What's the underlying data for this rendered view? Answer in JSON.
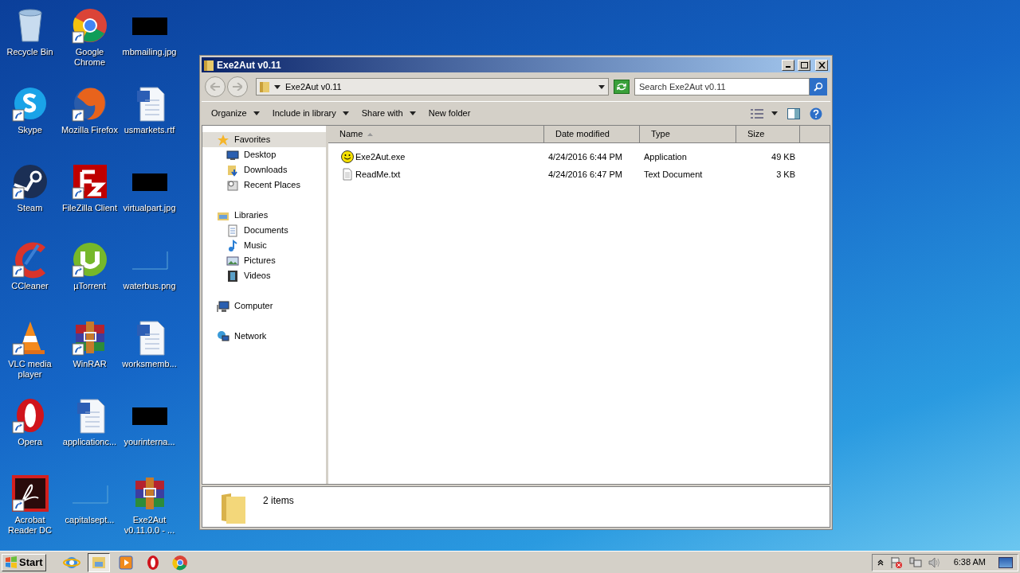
{
  "desktop_icons": [
    {
      "label": "Recycle Bin",
      "kind": "recycle-bin",
      "shortcut": false
    },
    {
      "label": "Skype",
      "kind": "skype",
      "shortcut": true
    },
    {
      "label": "Steam",
      "kind": "steam",
      "shortcut": true
    },
    {
      "label": "CCleaner",
      "kind": "ccleaner",
      "shortcut": true
    },
    {
      "label": "VLC media player",
      "kind": "vlc",
      "shortcut": true
    },
    {
      "label": "Opera",
      "kind": "opera",
      "shortcut": true
    },
    {
      "label": "Acrobat Reader DC",
      "kind": "acrobat",
      "shortcut": true
    },
    {
      "label": "Google Chrome",
      "kind": "chrome",
      "shortcut": true
    },
    {
      "label": "Mozilla Firefox",
      "kind": "firefox",
      "shortcut": true
    },
    {
      "label": "FileZilla Client",
      "kind": "filezilla",
      "shortcut": true
    },
    {
      "label": "µTorrent",
      "kind": "utorrent",
      "shortcut": true
    },
    {
      "label": "WinRAR",
      "kind": "winrar",
      "shortcut": true
    },
    {
      "label": "applicationc...",
      "kind": "document",
      "shortcut": false
    },
    {
      "label": "capitalsept...",
      "kind": "blank-image",
      "shortcut": false
    },
    {
      "label": "mbmailing.jpg",
      "kind": "dark-image",
      "shortcut": false
    },
    {
      "label": "usmarkets.rtf",
      "kind": "document",
      "shortcut": false
    },
    {
      "label": "virtualpart.jpg",
      "kind": "dark-image",
      "shortcut": false
    },
    {
      "label": "waterbus.png",
      "kind": "blank-image",
      "shortcut": false
    },
    {
      "label": "worksmemb...",
      "kind": "document",
      "shortcut": false
    },
    {
      "label": "yourinterna...",
      "kind": "dark-image",
      "shortcut": false
    },
    {
      "label": "Exe2Aut v0.11.0.0 - ...",
      "kind": "winrar",
      "shortcut": false
    }
  ],
  "window": {
    "title": "Exe2Aut v0.11",
    "address": "Exe2Aut v0.11",
    "search": {
      "placeholder": "Search Exe2Aut v0.11"
    },
    "toolbar": [
      {
        "label": "Organize",
        "dropdown": true
      },
      {
        "label": "Include in library",
        "dropdown": true
      },
      {
        "label": "Share with",
        "dropdown": true
      },
      {
        "label": "New folder",
        "dropdown": false
      }
    ],
    "navigation": [
      {
        "label": "Favorites",
        "kind": "favorites",
        "selected": true,
        "children": [
          {
            "label": "Desktop",
            "kind": "desktop",
            "selected": false
          },
          {
            "label": "Downloads",
            "kind": "downloads",
            "selected": false
          },
          {
            "label": "Recent Places",
            "kind": "recent",
            "selected": false
          }
        ]
      },
      {
        "label": "Libraries",
        "kind": "libraries",
        "selected": false,
        "children": [
          {
            "label": "Documents",
            "kind": "documents",
            "selected": false
          },
          {
            "label": "Music",
            "kind": "music",
            "selected": false
          },
          {
            "label": "Pictures",
            "kind": "pictures",
            "selected": false
          },
          {
            "label": "Videos",
            "kind": "videos",
            "selected": false
          }
        ]
      },
      {
        "label": "Computer",
        "kind": "computer",
        "selected": false
      },
      {
        "label": "Network",
        "kind": "network",
        "selected": false
      }
    ],
    "table": {
      "columns": [
        {
          "label": "Name",
          "sorted": true
        },
        {
          "label": "Date modified",
          "sorted": false
        },
        {
          "label": "Type",
          "sorted": false
        },
        {
          "label": "Size",
          "sorted": false
        }
      ],
      "rows": [
        {
          "name": "Exe2Aut.exe",
          "kind": "exe",
          "date": "4/24/2016 6:44 PM",
          "type": "Application",
          "size": "49 KB",
          "selected": false
        },
        {
          "name": "ReadMe.txt",
          "kind": "txt",
          "date": "4/24/2016 6:47 PM",
          "type": "Text Document",
          "size": "3 KB",
          "selected": false
        }
      ]
    },
    "status": "2 items"
  },
  "taskbar": {
    "start": "Start",
    "pinned": [
      {
        "kind": "ie",
        "selected": false
      },
      {
        "kind": "explorer",
        "selected": true
      },
      {
        "kind": "media",
        "selected": false
      },
      {
        "kind": "opera",
        "selected": false
      },
      {
        "kind": "chrome",
        "selected": false
      }
    ],
    "clock": "6:38 AM"
  }
}
